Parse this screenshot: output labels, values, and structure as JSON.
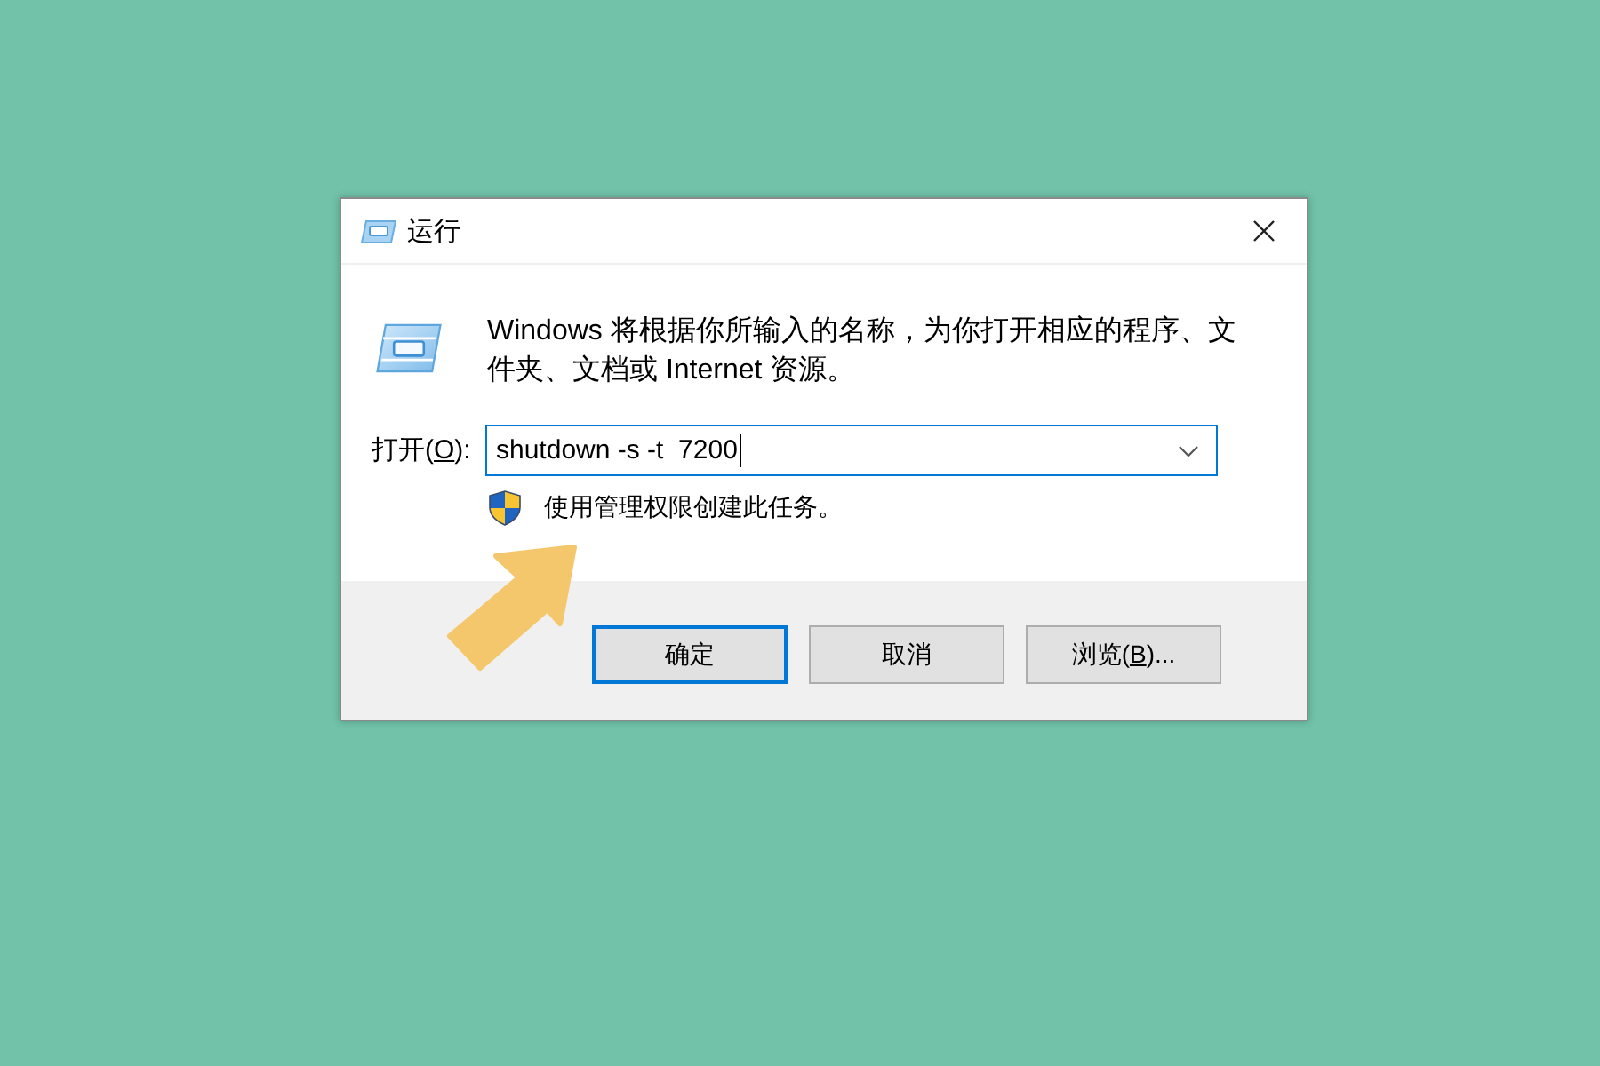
{
  "window": {
    "title": "运行"
  },
  "description": "Windows 将根据你所输入的名称，为你打开相应的程序、文件夹、文档或 Internet 资源。",
  "open_field": {
    "label": [
      {
        "text": "打开("
      },
      {
        "text": "O",
        "underlined": true
      },
      {
        "text": "):"
      }
    ],
    "value": "shutdown -s -t  7200",
    "focused": true
  },
  "admin_note": "使用管理权限创建此任务。",
  "buttons": [
    {
      "label": [
        {
          "text": "确定"
        }
      ],
      "default": true
    },
    {
      "label": [
        {
          "text": "取消"
        }
      ],
      "default": false
    },
    {
      "label": [
        {
          "text": "浏览("
        },
        {
          "text": "B",
          "underlined": true
        },
        {
          "text": ")..."
        }
      ],
      "default": false
    }
  ]
}
